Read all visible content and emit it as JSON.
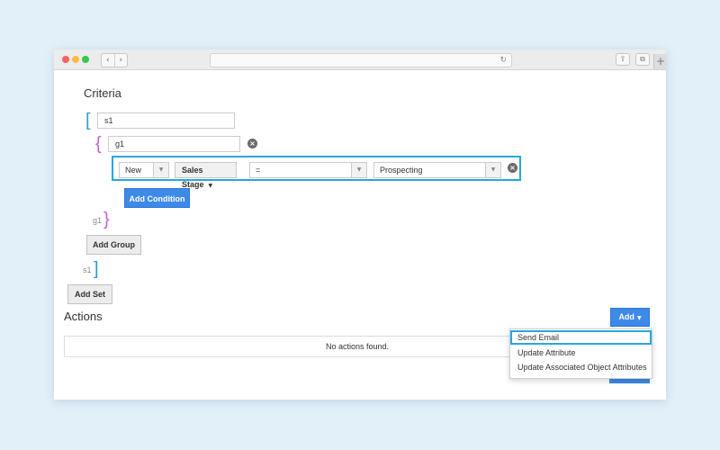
{
  "criteria": {
    "heading": "Criteria",
    "set": {
      "name_value": "s1",
      "close_tag": "s1",
      "add_set_label": "Add Set"
    },
    "group": {
      "name_value": "g1",
      "close_tag": "g1",
      "add_group_label": "Add Group"
    },
    "condition": {
      "field": "New",
      "stage": "Sales Stage",
      "operator": "=",
      "value": "Prospecting",
      "add_condition_label": "Add Condition"
    }
  },
  "actions": {
    "heading": "Actions",
    "empty_text": "No actions found.",
    "add_label": "Add",
    "menu": [
      "Send Email",
      "Update Attribute",
      "Update Associated Object Attributes"
    ]
  },
  "colors": {
    "accent": "#27a7df",
    "primary": "#3d8ae8",
    "set_bracket": "#2b9bd6",
    "group_bracket": "#c65fd2"
  },
  "icons": {
    "remove": "circle-x-icon",
    "dropdown": "caret-down-icon"
  }
}
